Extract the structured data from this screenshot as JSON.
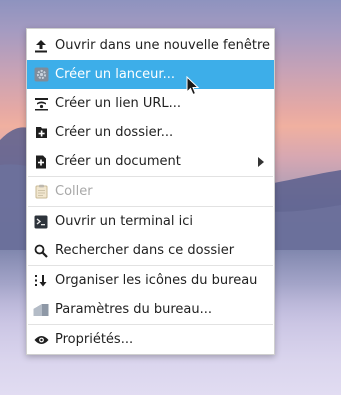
{
  "menu": {
    "items": [
      {
        "label": "Ouvrir dans une nouvelle fenêtre",
        "icon": "upload-arrow-icon",
        "state": "normal"
      },
      {
        "label": "Créer un lanceur...",
        "icon": "gear-icon",
        "state": "highlighted"
      },
      {
        "label": "Créer un lien URL...",
        "icon": "link-icon",
        "state": "normal"
      },
      {
        "label": "Créer un dossier...",
        "icon": "new-folder-icon",
        "state": "normal"
      },
      {
        "label": "Créer un document",
        "icon": "new-document-icon",
        "state": "normal",
        "submenu": true
      },
      {
        "label": "Coller",
        "icon": "clipboard-icon",
        "state": "disabled"
      },
      {
        "label": "Ouvrir un terminal ici",
        "icon": "terminal-icon",
        "state": "normal"
      },
      {
        "label": "Rechercher dans ce dossier",
        "icon": "search-icon",
        "state": "normal"
      },
      {
        "label": "Organiser les icônes du bureau",
        "icon": "sort-icon",
        "state": "normal"
      },
      {
        "label": "Paramètres du bureau...",
        "icon": "desktop-settings-icon",
        "state": "normal"
      },
      {
        "label": "Propriétés...",
        "icon": "eye-icon",
        "state": "normal"
      }
    ]
  },
  "colors": {
    "highlight": "#3daee9",
    "text": "#1f1f1f",
    "disabled_text": "#a8a8a8"
  }
}
